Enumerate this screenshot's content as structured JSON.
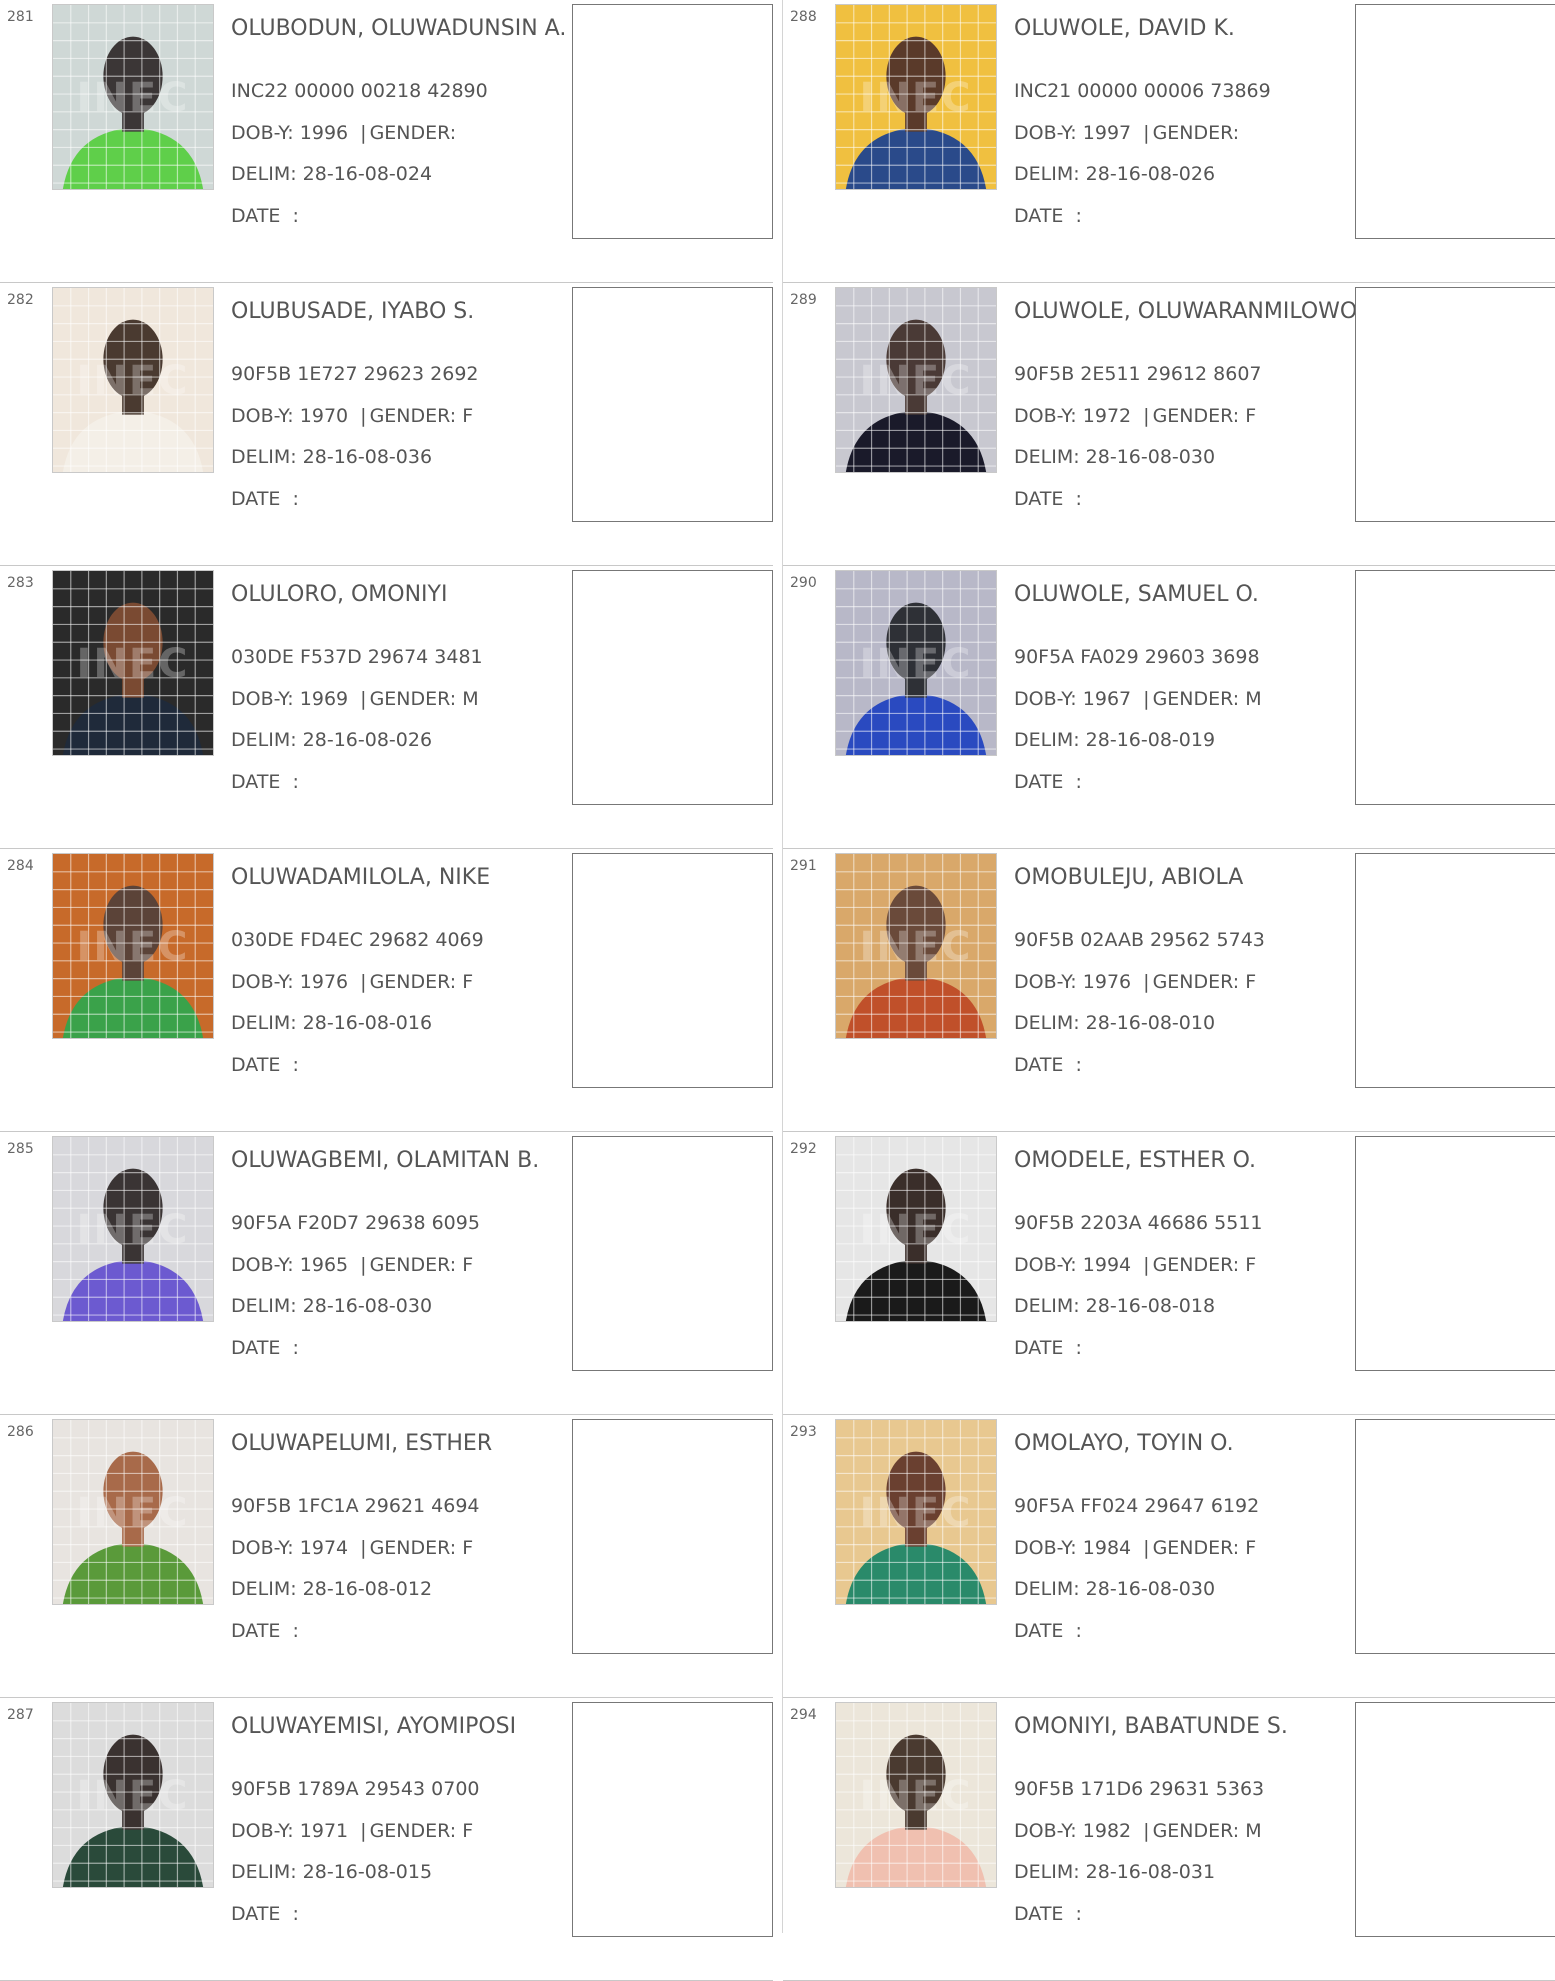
{
  "labels": {
    "dob": "DOB-Y:",
    "gender": "GENDER:",
    "delim": "DELIM:",
    "date": "DATE",
    "date_sep": ":",
    "separator": "|"
  },
  "watermark": "INEC",
  "left_entries": [
    {
      "num": "281",
      "name": "OLUBODUN, OLUWADUNSIN A.",
      "vin": "INC22 00000 00218 42890",
      "dob": "1996",
      "gender": "",
      "delim": "28-16-08-024",
      "photo": {
        "bg": "#cfd8d6",
        "skin": "#3b3636",
        "cloth": "#5fcf4a"
      }
    },
    {
      "num": "282",
      "name": "OLUBUSADE, IYABO S.",
      "vin": "90F5B 1E727 29623 2692",
      "dob": "1970",
      "gender": "F",
      "delim": "28-16-08-036",
      "photo": {
        "bg": "#f0e7dc",
        "skin": "#4a3a30",
        "cloth": "#f4efe7"
      }
    },
    {
      "num": "283",
      "name": "OLULORO, OMONIYI",
      "vin": "030DE F537D 29674 3481",
      "dob": "1969",
      "gender": "M",
      "delim": "28-16-08-026",
      "photo": {
        "bg": "#2a2a2a",
        "skin": "#7a4a32",
        "cloth": "#1f2a3a"
      }
    },
    {
      "num": "284",
      "name": "OLUWADAMILOLA, NIKE",
      "vin": "030DE FD4EC 29682 4069",
      "dob": "1976",
      "gender": "F",
      "delim": "28-16-08-016",
      "photo": {
        "bg": "#c76a2a",
        "skin": "#5b4338",
        "cloth": "#3aa24a"
      }
    },
    {
      "num": "285",
      "name": "OLUWAGBEMI, OLAMITAN B.",
      "vin": "90F5A F20D7 29638 6095",
      "dob": "1965",
      "gender": "F",
      "delim": "28-16-08-030",
      "photo": {
        "bg": "#d8d8dc",
        "skin": "#3a3434",
        "cloth": "#6c5ad0"
      }
    },
    {
      "num": "286",
      "name": "OLUWAPELUMI, ESTHER",
      "vin": "90F5B 1FC1A 29621 4694",
      "dob": "1974",
      "gender": "F",
      "delim": "28-16-08-012",
      "photo": {
        "bg": "#e8e4e0",
        "skin": "#a86a4a",
        "cloth": "#5a9a3a"
      }
    },
    {
      "num": "287",
      "name": "OLUWAYEMISI, AYOMIPOSI",
      "vin": "90F5B 1789A 29543 0700",
      "dob": "1971",
      "gender": "F",
      "delim": "28-16-08-015",
      "photo": {
        "bg": "#dcdcdc",
        "skin": "#3a3230",
        "cloth": "#2a4a3a"
      }
    }
  ],
  "right_entries": [
    {
      "num": "288",
      "name": "OLUWOLE, DAVID K.",
      "vin": "INC21 00000 00006 73869",
      "dob": "1997",
      "gender": "",
      "delim": "28-16-08-026",
      "photo": {
        "bg": "#f0c040",
        "skin": "#5a3a2a",
        "cloth": "#2a4a8a"
      }
    },
    {
      "num": "289",
      "name": "OLUWOLE, OLUWARANMILOWO",
      "vin": "90F5B 2E511 29612 8607",
      "dob": "1972",
      "gender": "F",
      "delim": "28-16-08-030",
      "photo": {
        "bg": "#c8c8d0",
        "skin": "#4a3a36",
        "cloth": "#1a1a2a"
      }
    },
    {
      "num": "290",
      "name": "OLUWOLE, SAMUEL O.",
      "vin": "90F5A FA029 29603 3698",
      "dob": "1967",
      "gender": "M",
      "delim": "28-16-08-019",
      "photo": {
        "bg": "#b8b8c8",
        "skin": "#2e3036",
        "cloth": "#2a4ac0"
      }
    },
    {
      "num": "291",
      "name": "OMOBULEJU, ABIOLA",
      "vin": "90F5B 02AAB 29562 5743",
      "dob": "1976",
      "gender": "F",
      "delim": "28-16-08-010",
      "photo": {
        "bg": "#d9a86a",
        "skin": "#6a4a3a",
        "cloth": "#c0502a"
      }
    },
    {
      "num": "292",
      "name": "OMODELE, ESTHER O.",
      "vin": "90F5B 2203A 46686 5511",
      "dob": "1994",
      "gender": "F",
      "delim": "28-16-08-018",
      "photo": {
        "bg": "#e6e6e6",
        "skin": "#3a2e2a",
        "cloth": "#1a1a1a"
      }
    },
    {
      "num": "293",
      "name": "OMOLAYO, TOYIN O.",
      "vin": "90F5A FF024 29647 6192",
      "dob": "1984",
      "gender": "F",
      "delim": "28-16-08-030",
      "photo": {
        "bg": "#e8c890",
        "skin": "#6a4030",
        "cloth": "#2a8a6a"
      }
    },
    {
      "num": "294",
      "name": "OMONIYI, BABATUNDE S.",
      "vin": "90F5B 171D6 29631 5363",
      "dob": "1982",
      "gender": "M",
      "delim": "28-16-08-031",
      "photo": {
        "bg": "#ece6da",
        "skin": "#4a3a30",
        "cloth": "#f0c0b0"
      }
    }
  ]
}
